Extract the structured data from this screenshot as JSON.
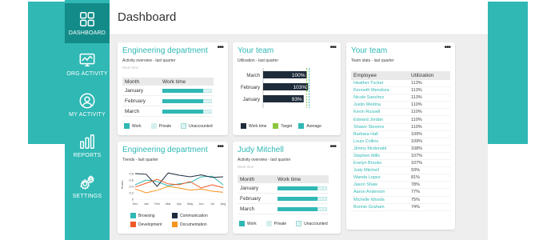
{
  "page": {
    "title": "Dashboard"
  },
  "nav": [
    {
      "label": "DASHBOARD",
      "icon": "dashboard-icon",
      "active": true
    },
    {
      "label": "ORG ACTIVITY",
      "icon": "monitor-icon",
      "active": false
    },
    {
      "label": "MY ACTIVITY",
      "icon": "user-icon",
      "active": false
    },
    {
      "label": "REPORTS",
      "icon": "bar-chart-icon",
      "active": false
    },
    {
      "label": "SETTINGS",
      "icon": "gear-icon",
      "active": false
    }
  ],
  "menu_glyph": "•••",
  "card_eng": {
    "title": "Engineering department",
    "subtitle": "Activity overview - last quarter",
    "hint": "Work time",
    "col_month": "Month",
    "col_work": "Work time",
    "rows": [
      {
        "month": "January",
        "work": 0.83
      },
      {
        "month": "February",
        "work": 0.83
      },
      {
        "month": "March",
        "work": 0.83
      }
    ],
    "legend": [
      "Work",
      "Private",
      "Unaccounted"
    ]
  },
  "card_team_util": {
    "title": "Your team",
    "subtitle": "Utilization - last quarter",
    "legend": [
      "Work time",
      "Target",
      "Average"
    ],
    "colors": {
      "work": "#1e2b3a",
      "target": "#8cc63f",
      "average": "#2fb8b4"
    }
  },
  "card_team_stats": {
    "title": "Your team",
    "subtitle": "Team stats - last quarter",
    "col_employee": "Employee",
    "col_util": "Utilization",
    "rows": [
      {
        "name": "Heather Tucker",
        "util": "113%"
      },
      {
        "name": "Kenneth Mendoza",
        "util": "113%"
      },
      {
        "name": "Nicole Sanchez",
        "util": "113%"
      },
      {
        "name": "Justin Medina",
        "util": "110%"
      },
      {
        "name": "Kevin Russell",
        "util": "110%"
      },
      {
        "name": "Edward Jordan",
        "util": "110%"
      },
      {
        "name": "Shawn Stevens",
        "util": "110%"
      },
      {
        "name": "Barbara Hall",
        "util": "109%"
      },
      {
        "name": "Louis Collins",
        "util": "109%"
      },
      {
        "name": "Jimmy Mcdonald",
        "util": "108%"
      },
      {
        "name": "Stephen Mills",
        "util": "107%"
      },
      {
        "name": "Evelyn Brooks",
        "util": "107%"
      },
      {
        "name": "Judy Mitchell",
        "util": "93%"
      },
      {
        "name": "Wanda Lopez",
        "util": "81%"
      },
      {
        "name": "Jason Shaw",
        "util": "78%"
      },
      {
        "name": "Aaron Anderson",
        "util": "77%"
      },
      {
        "name": "Michelle Woods",
        "util": "75%"
      },
      {
        "name": "Bonnie Graham",
        "util": "74%"
      }
    ]
  },
  "card_eng_trends": {
    "title": "Engineering department",
    "subtitle": "Trends - last quarter",
    "legend": [
      {
        "label": "Browsing",
        "color": "#2fb8b4"
      },
      {
        "label": "Communication",
        "color": "#1e2b3a"
      },
      {
        "label": "Development",
        "color": "#f05a28"
      },
      {
        "label": "Documentation",
        "color": "#f7941d"
      }
    ]
  },
  "card_judy": {
    "title": "Judy Mitchell",
    "subtitle": "Activity overview - last quarter",
    "hint": "Work time",
    "col_month": "Month",
    "col_work": "Work time",
    "rows": [
      {
        "month": "January",
        "work": 0.8
      },
      {
        "month": "February",
        "work": 0.8
      },
      {
        "month": "March",
        "work": 0.8
      }
    ],
    "legend": [
      "Work",
      "Private",
      "Unaccounted"
    ]
  },
  "chart_data": [
    {
      "type": "bar",
      "orientation": "horizontal",
      "categories": [
        "March",
        "February",
        "January"
      ],
      "series": [
        {
          "values": [
            100,
            103,
            93
          ]
        }
      ],
      "data_labels": [
        "100%",
        "103%",
        "93%"
      ],
      "xlim": [
        0,
        110
      ]
    },
    {
      "type": "line",
      "x": [
        "Dec",
        "Jan",
        "Feb",
        "Mar",
        "Apr",
        "May",
        "Jun",
        "Jul",
        "Aug"
      ],
      "ylabel": "Hours",
      "ylim": [
        0,
        1
      ],
      "yticks": [
        "0.8",
        "0.6",
        "0.4",
        "0.2",
        "0"
      ],
      "series": [
        {
          "name": "Browsing",
          "values": [
            0.45,
            0.6,
            0.55,
            0.42,
            0.48,
            0.52,
            0.7,
            0.72,
            0.45
          ]
        },
        {
          "name": "Communication",
          "values": [
            0.8,
            0.78,
            0.4,
            0.82,
            0.75,
            0.7,
            0.76,
            0.68,
            0.7
          ]
        },
        {
          "name": "Development",
          "values": [
            0.38,
            0.5,
            0.62,
            0.48,
            0.45,
            0.55,
            0.35,
            0.45,
            0.36
          ]
        },
        {
          "name": "Documentation",
          "values": [
            0.32,
            0.2,
            0.28,
            0.4,
            0.35,
            0.28,
            0.32,
            0.25,
            0.22
          ]
        }
      ]
    }
  ]
}
